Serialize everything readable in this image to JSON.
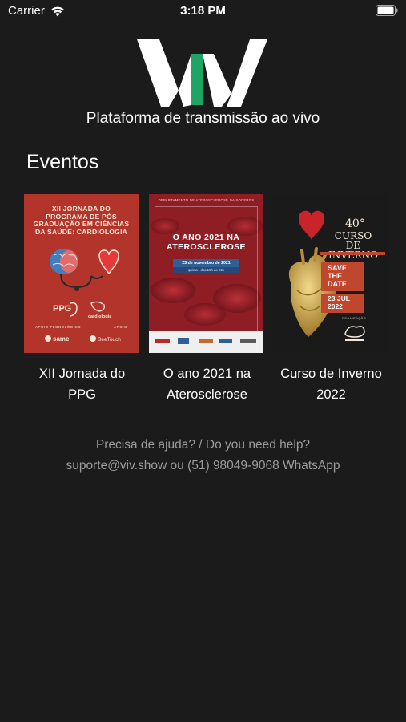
{
  "status_bar": {
    "carrier": "Carrier",
    "time": "3:18 PM"
  },
  "brand": {
    "logo_letters": "VIV",
    "tagline": "Plataforma de transmissão ao vivo",
    "accent_color": "#1fa464"
  },
  "events": {
    "title": "Eventos",
    "items": [
      {
        "caption_line1": "XII Jornada do",
        "caption_line2": "PPG",
        "poster": {
          "title": "XII JORNADA DO PROGRAMA DE PÓS GRADUAÇÃO EM CIÊNCIAS DA SAÚDE: CARDIOLOGIA",
          "logo_ppg": "PPG",
          "logo_institute": "cardiologia",
          "support_label_left": "APOIO TECNOLÓGICO",
          "support_label_right": "APOIO",
          "sponsor_left": "same",
          "sponsor_right": "BeeTouch",
          "bg_color": "#b3342a"
        }
      },
      {
        "caption_line1": "O ano 2021 na",
        "caption_line2": "Aterosclerose",
        "poster": {
          "header": "DEPARTAMENTO DE ATEROSCLEROSE DA SOCERGS",
          "title_line1": "O ANO 2021 NA",
          "title_line2": "ATEROSCLEROSE",
          "date": "25 de novembro de 2021",
          "time": "quinta - das 19h às 21h",
          "bg_color": "#8f1d24"
        }
      },
      {
        "caption_line1": "Curso de Inverno",
        "caption_line2": "2022",
        "poster": {
          "number": "40°",
          "title_line1": "CURSO",
          "title_line2": "DE INVERNO",
          "save_line1": "SAVE",
          "save_line2": "THE",
          "save_line3": "DATE",
          "date_line1": "23",
          "date_line2": "JUL",
          "date_line3": "2022",
          "realization_label": "REALIZAÇÃO",
          "bg_color": "#1a1a1a"
        }
      }
    ]
  },
  "help": {
    "line1": "Precisa de ajuda? / Do you need help?",
    "line2": "suporte@viv.show ou (51) 98049-9068 WhatsApp"
  }
}
